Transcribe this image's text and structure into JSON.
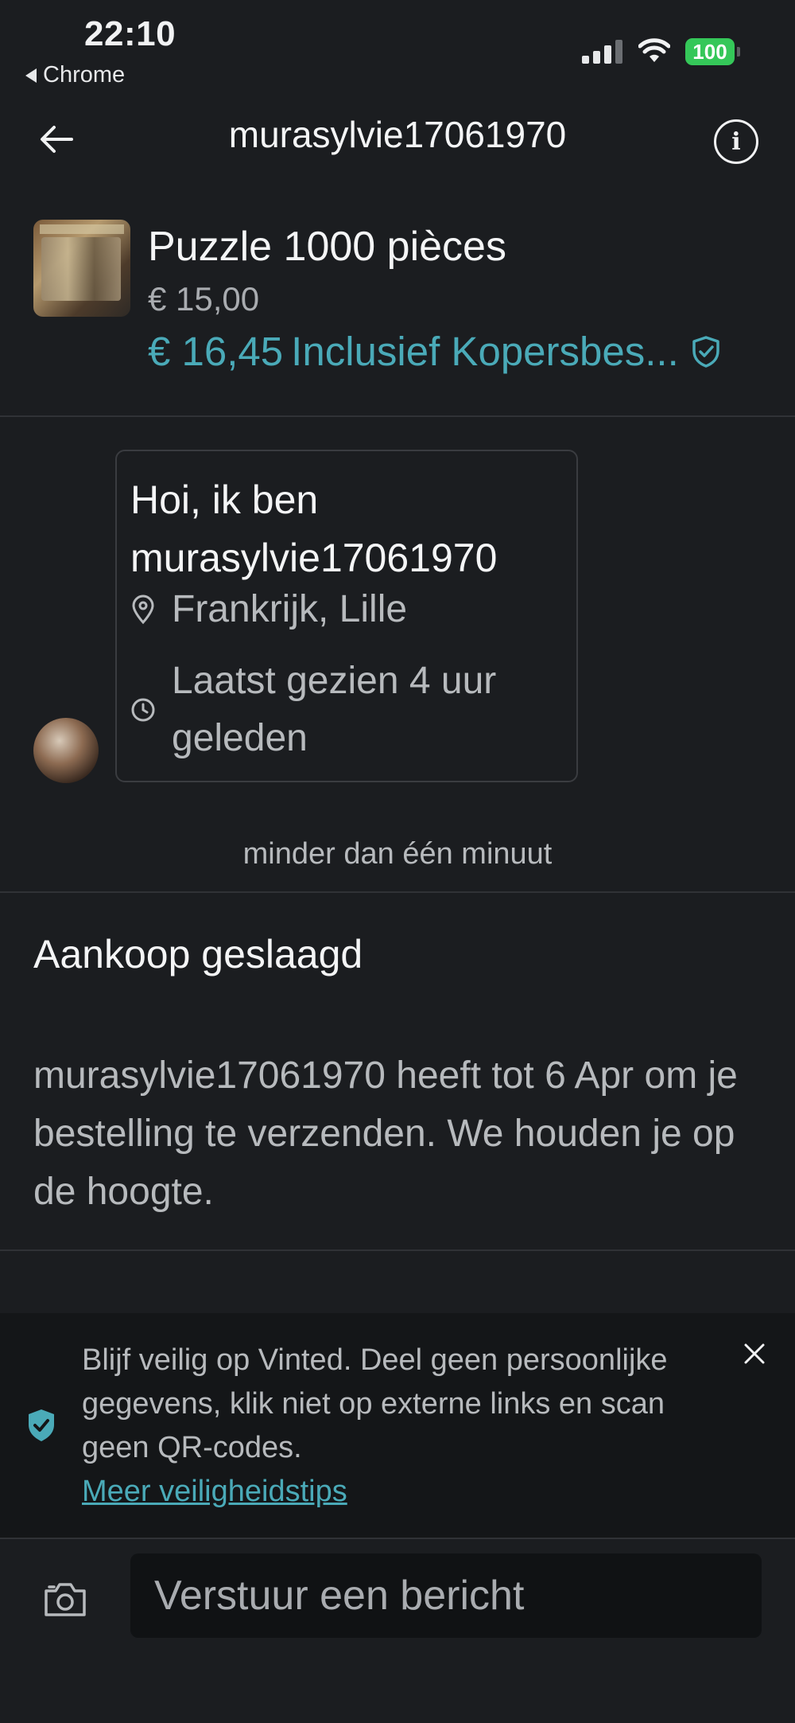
{
  "status_bar": {
    "time": "22:10",
    "back_app": "Chrome",
    "battery": "100"
  },
  "header": {
    "title": "murasylvie17061970",
    "back_icon": "arrow-left-icon",
    "info_icon": "info-icon"
  },
  "product": {
    "title": "Puzzle 1000 pièces",
    "price": "€ 15,00",
    "total_price": "€ 16,45",
    "total_note": "Inclusief Kopersbes...",
    "shield_icon": "shield-check-icon"
  },
  "intro_card": {
    "title": "Hoi, ik ben murasylvie17061970",
    "location": "Frankrijk, Lille",
    "last_seen": "Laatst gezien 4 uur geleden"
  },
  "timestamp": "minder dan één minuut",
  "purchase": {
    "title": "Aankoop geslaagd",
    "text": "murasylvie17061970 heeft tot 6 Apr om je bestelling te verzenden. We houden je op de hoogte."
  },
  "safety_banner": {
    "text": "Blijf veilig op Vinted. Deel geen persoonlijke gegevens, klik niet op externe links en scan geen QR-codes.",
    "link": "Meer veiligheidstips"
  },
  "composer": {
    "placeholder": "Verstuur een bericht"
  },
  "colors": {
    "background": "#1b1d20",
    "accent": "#4aaab8",
    "battery": "#35c759"
  }
}
